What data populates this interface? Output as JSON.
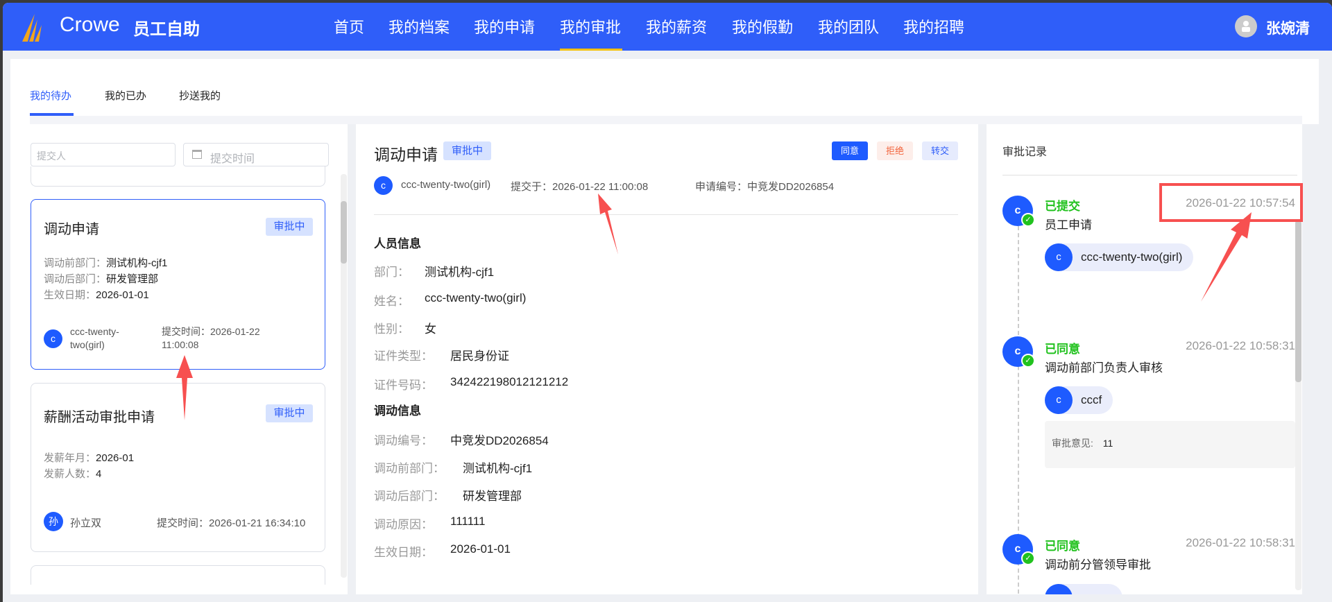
{
  "header": {
    "logo_text": "Crowe",
    "app_name": "员工自助",
    "nav": [
      "首页",
      "我的档案",
      "我的申请",
      "我的审批",
      "我的薪资",
      "我的假勤",
      "我的团队",
      "我的招聘"
    ],
    "active_nav": "我的审批",
    "user_name": "张婉清"
  },
  "tabs": [
    "我的待办",
    "我的已办",
    "抄送我的"
  ],
  "filters": {
    "submitter_placeholder": "提交人",
    "time_placeholder": "提交时间"
  },
  "cards": [
    {
      "title": "调动申请",
      "status": "审批中",
      "lines": [
        [
          "调动前部门：",
          "测试机构-cjf1"
        ],
        [
          "调动后部门：",
          "研发管理部"
        ],
        [
          "生效日期：",
          "2026-01-01"
        ]
      ],
      "avatar": "c",
      "submitter": "ccc-twenty-two(girl)",
      "time_label": "提交时间：",
      "time": "2026-01-22 11:00:08"
    },
    {
      "title": "薪酬活动审批申请",
      "status": "审批中",
      "lines": [
        [
          "发薪年月：",
          "2026-01"
        ],
        [
          "发薪人数：",
          "4"
        ]
      ],
      "avatar": "孙",
      "submitter": "孙立双",
      "time_label": "提交时间：",
      "time": "2026-01-21 16:34:10"
    }
  ],
  "detail": {
    "title": "调动申请",
    "status": "审批中",
    "buttons": {
      "agree": "同意",
      "reject": "拒绝",
      "transfer": "转交"
    },
    "avatar": "c",
    "submitter": "ccc-twenty-two(girl)",
    "submitted_at": "提交于：2026-01-22 11:00:08",
    "apply_no": "申请编号：中竞发DD2026854",
    "person_section": "人员信息",
    "person": [
      [
        "部门：",
        "测试机构-cjf1"
      ],
      [
        "姓名：",
        "ccc-twenty-two(girl)"
      ],
      [
        "性别：",
        "女"
      ],
      [
        "证件类型：",
        "居民身份证"
      ],
      [
        "证件号码：",
        "342422198012121212"
      ]
    ],
    "transfer_section": "调动信息",
    "transfer": [
      [
        "调动编号：",
        "中竞发DD2026854"
      ],
      [
        "调动前部门：",
        "测试机构-cjf1"
      ],
      [
        "调动后部门：",
        "研发管理部"
      ],
      [
        "调动原因：",
        "111111"
      ],
      [
        "生效日期：",
        "2026-01-01"
      ]
    ]
  },
  "records": {
    "title": "审批记录",
    "items": [
      {
        "avatar": "c",
        "status": "已提交",
        "step": "员工申请",
        "time": "2026-01-22 10:57:54",
        "person": "ccc-twenty-two(girl)"
      },
      {
        "avatar": "c",
        "status": "已同意",
        "step": "调动前部门负责人审核",
        "time": "2026-01-22 10:58:31",
        "person": "cccf",
        "opinion_label": "审批意见:",
        "opinion": "11"
      },
      {
        "avatar": "c",
        "status": "已同意",
        "step": "调动前分管领导审批",
        "time": "2026-01-22 10:58:31"
      }
    ]
  },
  "colors": {
    "primary": "#2f5ef9",
    "success": "#21c21e",
    "accent": "#f5c000",
    "annotation": "#f75050"
  }
}
